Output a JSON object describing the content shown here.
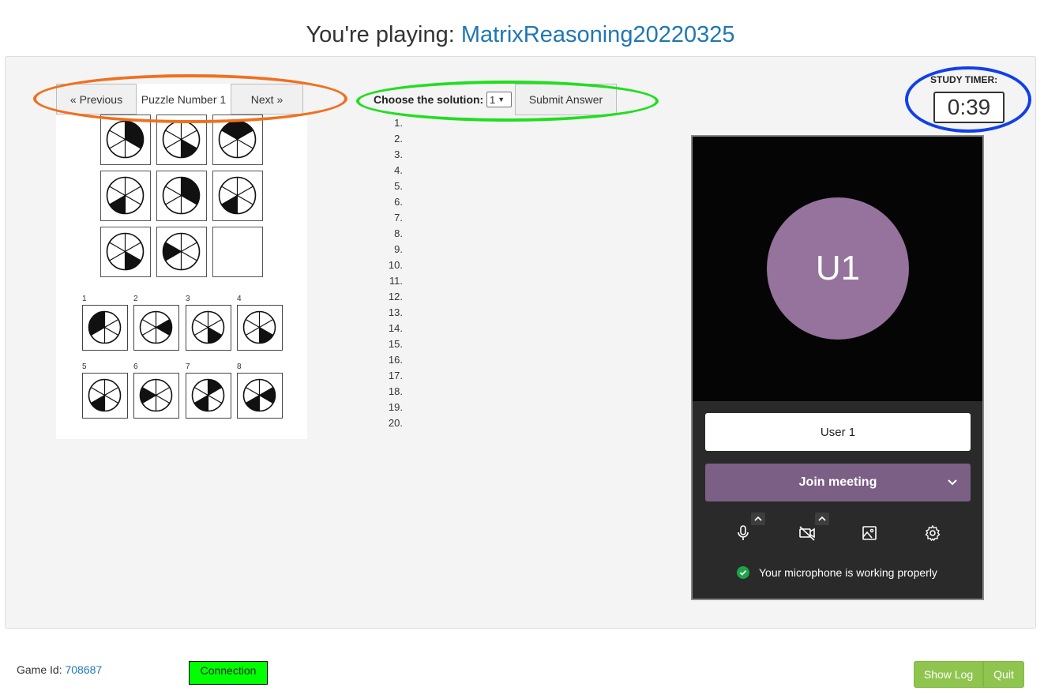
{
  "header": {
    "prefix": "You're playing: ",
    "game_name": "MatrixReasoning20220325"
  },
  "puzzle_nav": {
    "previous_label": "« Previous",
    "puzzle_label": "Puzzle Number 1",
    "next_label": "Next »"
  },
  "puzzle": {
    "option_numbers": [
      "1",
      "2",
      "3",
      "4",
      "5",
      "6",
      "7",
      "8"
    ]
  },
  "solution": {
    "label": "Choose the solution:",
    "selected": "1",
    "submit_label": "Submit Answer",
    "answers": [
      "1.",
      "2.",
      "3.",
      "4.",
      "5.",
      "6.",
      "7.",
      "8.",
      "9.",
      "10.",
      "11.",
      "12.",
      "13.",
      "14.",
      "15.",
      "16.",
      "17.",
      "18.",
      "19.",
      "20."
    ]
  },
  "timer": {
    "label": "STUDY TIMER:",
    "value": "0:39"
  },
  "video": {
    "avatar_initials": "U1",
    "name_value": "User 1",
    "join_label": "Join meeting",
    "mic_status": "Your microphone is working properly",
    "icons": [
      "microphone-icon",
      "camera-off-icon",
      "background-image-icon",
      "gear-icon",
      "chevron-down-icon",
      "check-circle-icon"
    ]
  },
  "footer": {
    "game_id_label": "Game Id: ",
    "game_id": "708687",
    "connection_label": "Connection",
    "show_log_label": "Show Log",
    "quit_label": "Quit"
  },
  "colors": {
    "link_blue": "#1f77b4",
    "avatar_purple": "#95739c",
    "join_purple": "#7b5f85",
    "connection_green": "#00ff00",
    "button_green": "#8fc54e",
    "annotation_orange": "#f07020",
    "annotation_green": "#22dd22",
    "annotation_blue": "#1040e8"
  }
}
